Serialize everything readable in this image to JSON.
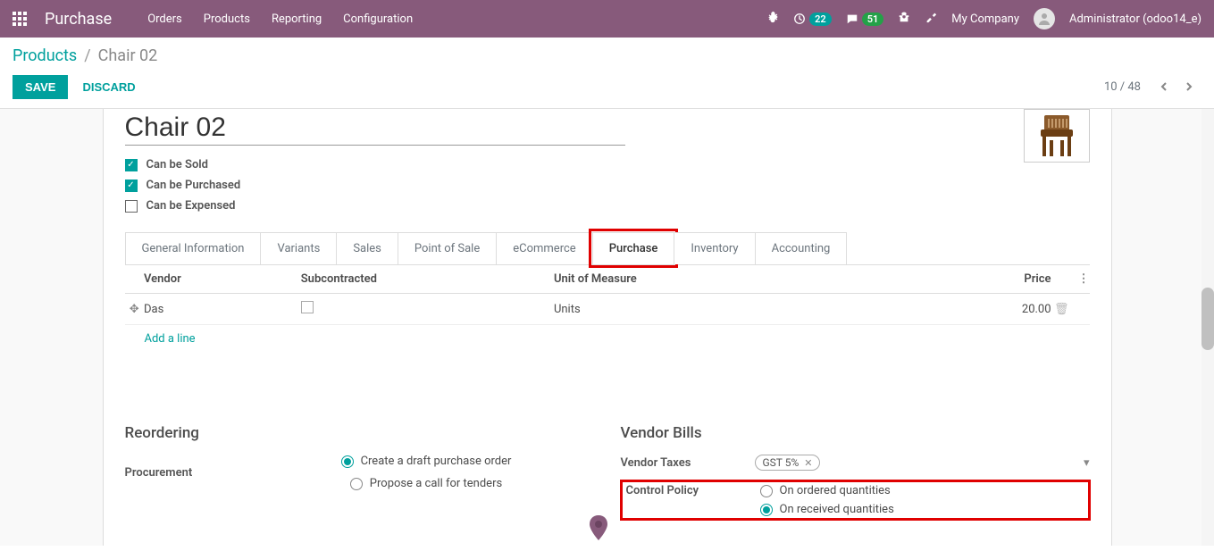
{
  "colors": {
    "brand": "#875a7b",
    "primary": "#00a09d",
    "highlight": "#e00000"
  },
  "topnav": {
    "app_title": "Purchase",
    "menu": [
      "Orders",
      "Products",
      "Reporting",
      "Configuration"
    ],
    "badge_activities": "22",
    "badge_discuss": "51",
    "company": "My Company",
    "user": "Administrator (odoo14_e)"
  },
  "breadcrumb": {
    "parent": "Products",
    "current": "Chair 02"
  },
  "actions": {
    "save": "SAVE",
    "discard": "DISCARD",
    "pager": "10 / 48"
  },
  "title": "Chair 02",
  "checks": {
    "sold": {
      "label": "Can be Sold",
      "checked": true
    },
    "purchased": {
      "label": "Can be Purchased",
      "checked": true
    },
    "expensed": {
      "label": "Can be Expensed",
      "checked": false
    }
  },
  "tabs": [
    "General Information",
    "Variants",
    "Sales",
    "Point of Sale",
    "eCommerce",
    "Purchase",
    "Inventory",
    "Accounting"
  ],
  "active_tab": "Purchase",
  "vendor_table": {
    "headers": {
      "vendor": "Vendor",
      "subcontracted": "Subcontracted",
      "uom": "Unit of Measure",
      "price": "Price"
    },
    "rows": [
      {
        "vendor": "Das",
        "subcontracted": false,
        "uom": "Units",
        "price": "20.00"
      }
    ],
    "add_line": "Add a line"
  },
  "reordering": {
    "title": "Reordering",
    "procurement_label": "Procurement",
    "options": {
      "draft": "Create a draft purchase order",
      "tender": "Propose a call for tenders"
    },
    "selected": "draft"
  },
  "vendor_bills": {
    "title": "Vendor Bills",
    "taxes_label": "Vendor Taxes",
    "tax_tag": "GST 5%",
    "control_label": "Control Policy",
    "options": {
      "ordered": "On ordered quantities",
      "received": "On received quantities"
    },
    "selected": "received"
  }
}
